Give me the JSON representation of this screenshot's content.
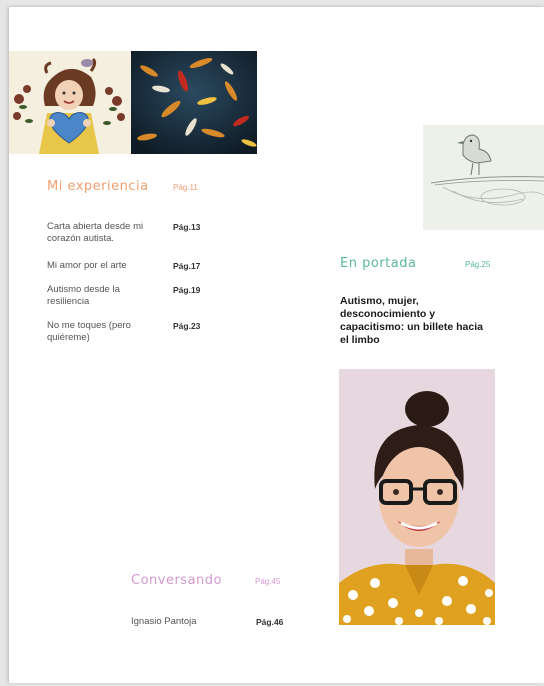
{
  "sections": {
    "experiencia": {
      "title": "Mi experiencia",
      "page": "Pág.11",
      "color": "#f0a070",
      "items": [
        {
          "title": "Carta abierta desde mi corazón autista.",
          "page": "Pág.13"
        },
        {
          "title": "Mi amor por el arte",
          "page": "Pág.17"
        },
        {
          "title": "Autismo desde la resiliencia",
          "page": "Pág.19"
        },
        {
          "title": "No me toques (pero quiéreme)",
          "page": "Pág.23"
        }
      ]
    },
    "portada": {
      "title": "En portada",
      "page": "Pág.25",
      "color": "#5ab896",
      "headline": "Autismo, mujer, desconocimiento y capacitismo: un billete hacia el limbo"
    },
    "conversando": {
      "title": "Conversando",
      "page": "Pág.45",
      "color": "#d49ad0",
      "items": [
        {
          "title": "Ignasio Pantoja",
          "page": "Pág.46"
        }
      ]
    }
  }
}
